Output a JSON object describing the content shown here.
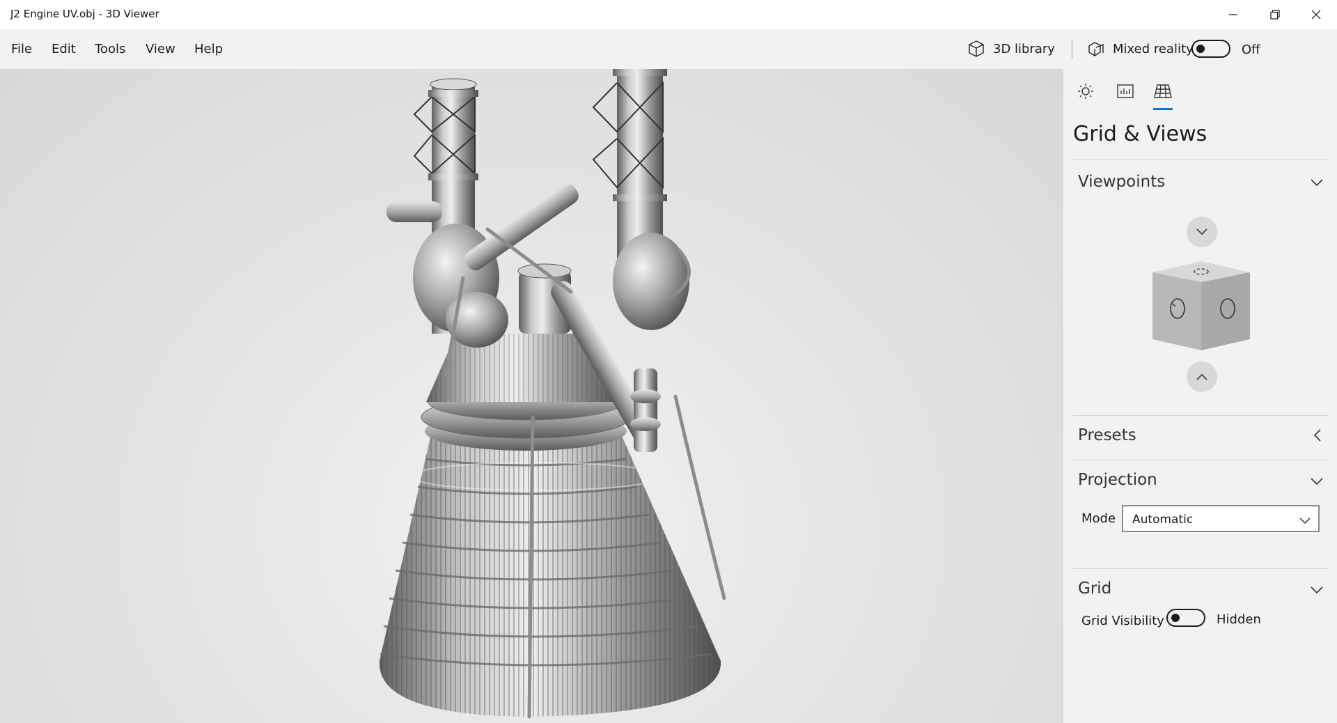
{
  "window": {
    "title": "J2 Engine UV.obj - 3D Viewer"
  },
  "menu": {
    "items": [
      "File",
      "Edit",
      "Tools",
      "View",
      "Help"
    ]
  },
  "toolbar": {
    "library_label": "3D library",
    "mixed_reality_label": "Mixed reality",
    "mixed_reality_state": "Off"
  },
  "panel": {
    "title": "Grid & Views",
    "viewpoints_label": "Viewpoints",
    "presets_label": "Presets",
    "projection_label": "Projection",
    "mode_label": "Mode",
    "mode_value": "Automatic",
    "grid_label": "Grid",
    "grid_visibility_label": "Grid Visibility",
    "grid_visibility_state": "Hidden"
  },
  "colors": {
    "accent": "#0078d7",
    "panel_bg": "#f2f2f2",
    "viewport_bg": "#e2e3e4"
  }
}
